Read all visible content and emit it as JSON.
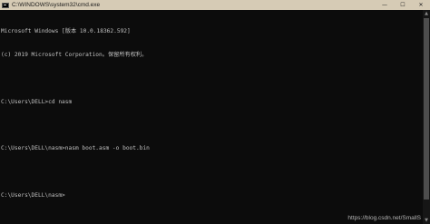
{
  "window": {
    "title": "C:\\WINDOWS\\system32\\cmd.exe"
  },
  "controls": {
    "minimize": "—",
    "maximize": "☐",
    "close": "✕"
  },
  "console": {
    "lines": [
      "Microsoft Windows [版本 10.0.18362.592]",
      "(c) 2019 Microsoft Corporation。保留所有权利。",
      "",
      "C:\\Users\\DELL>cd nasm",
      "",
      "C:\\Users\\DELL\\nasm>nasm boot.asm -o boot.bin",
      "",
      "C:\\Users\\DELL\\nasm>"
    ]
  },
  "watermark": "https://blog.csdn.net/SmallS"
}
